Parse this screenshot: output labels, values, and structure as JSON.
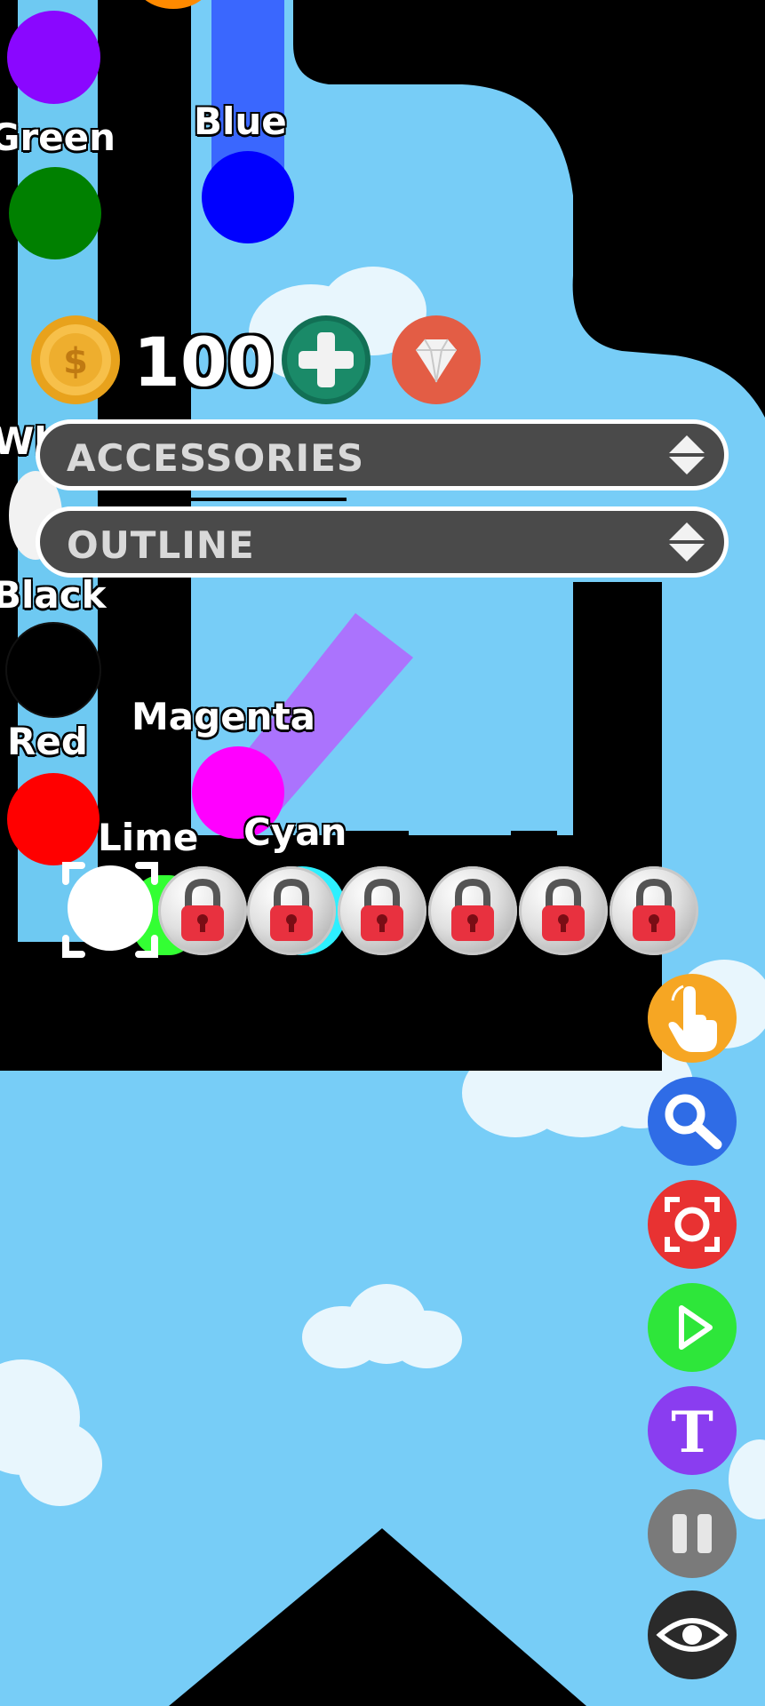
{
  "hud": {
    "coins": "100",
    "coin_icon": "dollar-coin-icon",
    "add_icon": "plus-icon",
    "gem_icon": "diamond-icon"
  },
  "dropdowns": [
    {
      "label": "ACCESSORIES",
      "icon": "up-down-arrows-icon"
    },
    {
      "label": "OUTLINE",
      "icon": "up-down-arrows-icon"
    }
  ],
  "marble_labels": {
    "blue": "Blue",
    "green": "Green",
    "white": "Wh",
    "black": "Black",
    "red": "Red",
    "magenta": "Magenta",
    "lime": "Lime",
    "cyan": "Cyan"
  },
  "marble_colors": {
    "purple": "#8a07ff",
    "blue": "#0000ff",
    "green": "#008000",
    "black": "#000000",
    "red": "#ff0000",
    "magenta": "#ff00ff",
    "white": "#ffffff"
  },
  "slots": {
    "selected": "white-marble",
    "locked_count": 6,
    "lock_icon": "padlock-icon"
  },
  "side_buttons": [
    {
      "name": "tap-button",
      "icon": "hand-pointer-icon",
      "color": "#f6a623"
    },
    {
      "name": "search-button",
      "icon": "magnifier-icon",
      "color": "#2f6ce6"
    },
    {
      "name": "focus-button",
      "icon": "focus-frame-icon",
      "color": "#e83232"
    },
    {
      "name": "play-button",
      "icon": "play-icon",
      "color": "#2ee63a"
    },
    {
      "name": "text-button",
      "icon": "letter-t-icon",
      "color": "#8a3df0"
    },
    {
      "name": "pause-button",
      "icon": "pause-icon",
      "color": "#7a7a7a"
    },
    {
      "name": "view-button",
      "icon": "eye-icon",
      "color": "#2a2a2a"
    }
  ]
}
